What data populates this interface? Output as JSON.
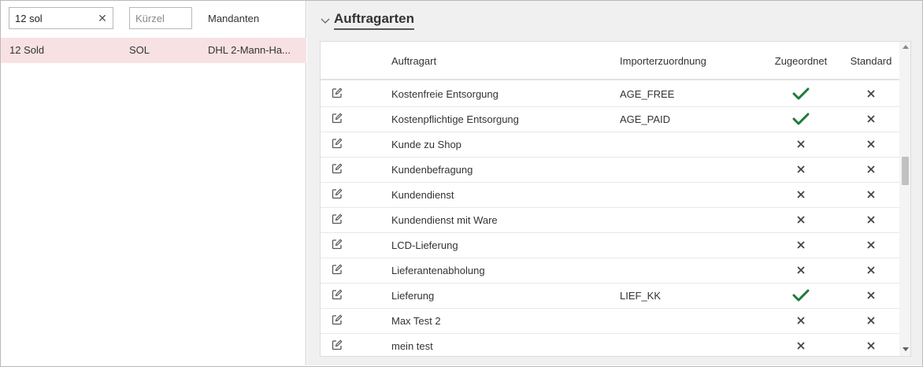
{
  "left_panel": {
    "search": {
      "value": "12 sol",
      "clear_icon": "close-icon"
    },
    "kuerzel_filter": {
      "value": "",
      "placeholder": "Kürzel"
    },
    "mandanten_header": "Mandanten",
    "rows": [
      {
        "name": "12 Sold",
        "kuerzel": "SOL",
        "mandanten": "DHL 2-Mann-Ha..."
      }
    ]
  },
  "section": {
    "title": "Auftragarten",
    "toggle_icon": "chevron-down-icon"
  },
  "table": {
    "columns": {
      "auftragart": "Auftragart",
      "importer": "Importerzuordnung",
      "zugeordnet": "Zugeordnet",
      "standard": "Standard"
    },
    "rows": [
      {
        "auftragart": "Kostenfreie Entsorgung",
        "importer": "AGE_FREE",
        "zugeordnet": true,
        "standard": false
      },
      {
        "auftragart": "Kostenpflichtige Entsorgung",
        "importer": "AGE_PAID",
        "zugeordnet": true,
        "standard": false
      },
      {
        "auftragart": "Kunde zu Shop",
        "importer": "",
        "zugeordnet": false,
        "standard": false
      },
      {
        "auftragart": "Kundenbefragung",
        "importer": "",
        "zugeordnet": false,
        "standard": false
      },
      {
        "auftragart": "Kundendienst",
        "importer": "",
        "zugeordnet": false,
        "standard": false
      },
      {
        "auftragart": "Kundendienst mit Ware",
        "importer": "",
        "zugeordnet": false,
        "standard": false
      },
      {
        "auftragart": "LCD-Lieferung",
        "importer": "",
        "zugeordnet": false,
        "standard": false
      },
      {
        "auftragart": "Lieferantenabholung",
        "importer": "",
        "zugeordnet": false,
        "standard": false
      },
      {
        "auftragart": "Lieferung",
        "importer": "LIEF_KK",
        "zugeordnet": true,
        "standard": false
      },
      {
        "auftragart": "Max Test 2",
        "importer": "",
        "zugeordnet": false,
        "standard": false
      },
      {
        "auftragart": "mein test",
        "importer": "",
        "zugeordnet": false,
        "standard": false
      }
    ]
  },
  "colors": {
    "selected_row": "#f8e1e3",
    "check_green": "#1e7a3a",
    "cross_gray": "#444444"
  },
  "icons": {
    "edit": "edit-icon",
    "check": "check-icon",
    "cross": "close-icon"
  }
}
